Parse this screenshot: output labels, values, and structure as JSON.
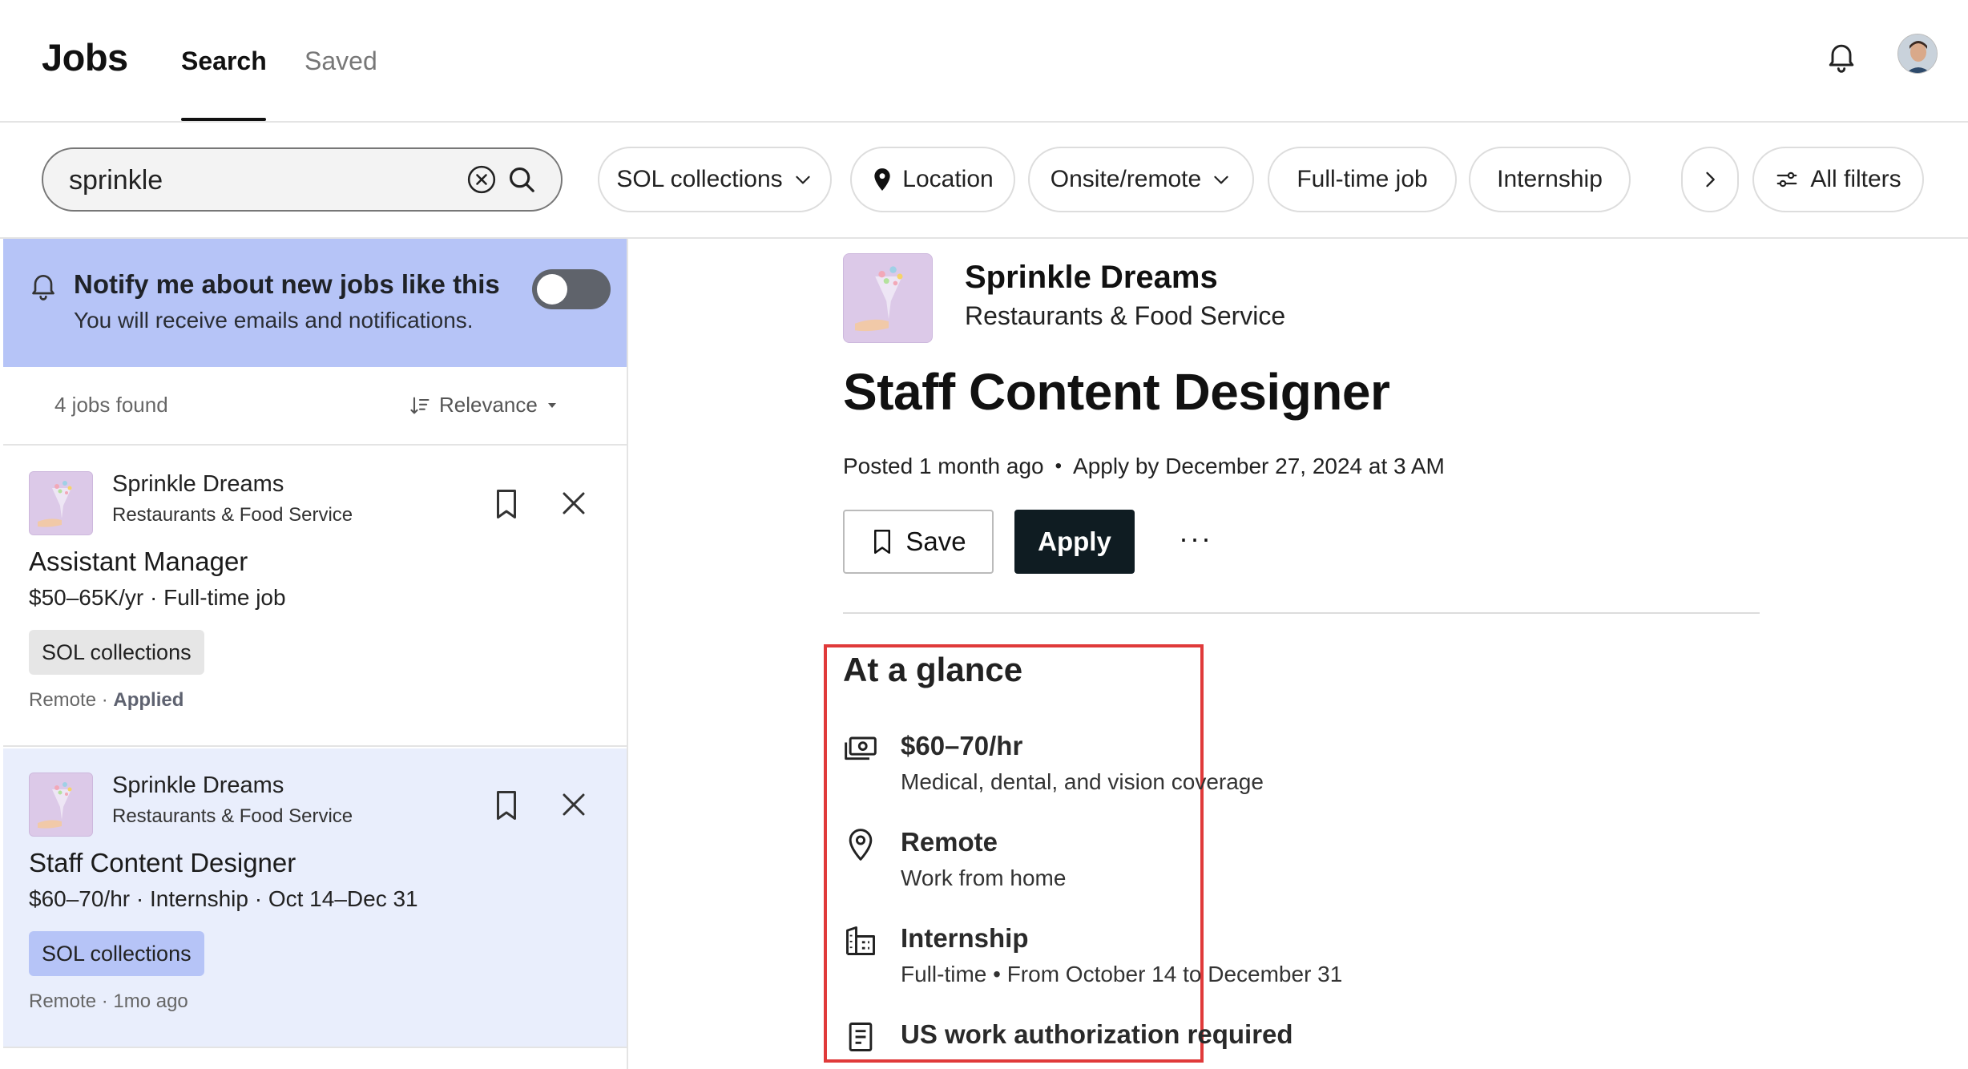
{
  "app": {
    "title": "Jobs"
  },
  "nav": {
    "tabs": [
      {
        "label": "Search",
        "active": true
      },
      {
        "label": "Saved",
        "active": false
      }
    ]
  },
  "search": {
    "value": "sprinkle"
  },
  "filters": {
    "chips": [
      {
        "label": "SOL collections",
        "has_dropdown": true
      },
      {
        "label": "Location",
        "icon": "pin-icon"
      },
      {
        "label": "Onsite/remote",
        "has_dropdown": true
      },
      {
        "label": "Full-time job"
      },
      {
        "label": "Internship"
      }
    ],
    "all_filters_label": "All filters"
  },
  "notify": {
    "title": "Notify me about new jobs like this",
    "subtitle": "You will receive emails and notifications.",
    "enabled": false
  },
  "results": {
    "count_label": "4 jobs found",
    "sort_label": "Relevance"
  },
  "jobs": [
    {
      "company": "Sprinkle Dreams",
      "industry": "Restaurants & Food Service",
      "title": "Assistant Manager",
      "meta": "$50–65K/yr · Full-time job",
      "tag": "SOL collections",
      "location": "Remote",
      "status": "Applied",
      "selected": false
    },
    {
      "company": "Sprinkle Dreams",
      "industry": "Restaurants & Food Service",
      "title": "Staff Content Designer",
      "meta": "$60–70/hr · Internship · Oct 14–Dec 31",
      "tag": "SOL collections",
      "location": "Remote",
      "age": "1mo ago",
      "selected": true
    }
  ],
  "detail": {
    "company": "Sprinkle Dreams",
    "industry": "Restaurants & Food Service",
    "title": "Staff Content Designer",
    "posted": "Posted 1 month ago",
    "apply_by": "Apply by December 27, 2024 at 3 AM",
    "save_label": "Save",
    "apply_label": "Apply",
    "more_label": "···",
    "glance": {
      "title": "At a glance",
      "items": [
        {
          "icon": "money-icon",
          "title": "$60–70/hr",
          "subtitle": "Medical, dental, and vision coverage"
        },
        {
          "icon": "location-pin-icon",
          "title": "Remote",
          "subtitle": "Work from home"
        },
        {
          "icon": "building-icon",
          "title": "Internship",
          "subtitle": "Full-time  •  From October 14 to December 31"
        },
        {
          "icon": "document-icon",
          "title": "US work authorization required",
          "subtitle": ""
        }
      ]
    }
  },
  "colors": {
    "notify_bg": "#b6c4f7",
    "selected_card_bg": "#e9eefc",
    "apply_button_bg": "#0f1c22",
    "highlight_border": "#e03a3a"
  }
}
